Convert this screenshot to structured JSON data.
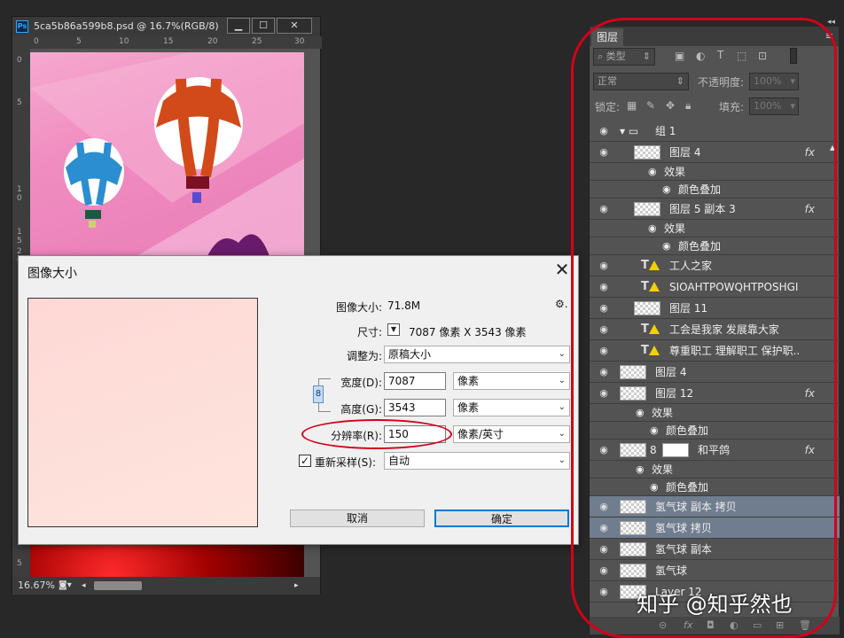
{
  "document": {
    "title": "5ca5b86a599b8.psd @ 16.7%(RGB/8)",
    "app_badge": "Ps",
    "minimize": "▁",
    "maximize": "☐",
    "close": "✕",
    "ruler_top": [
      "0",
      "5",
      "10",
      "15",
      "20",
      "25",
      "30"
    ],
    "ruler_left": [
      "0",
      "5",
      "1",
      "0",
      "1",
      "5",
      "2",
      "0",
      "5"
    ],
    "zoom": "16.67%"
  },
  "dialog": {
    "title": "图像大小",
    "close": "✕",
    "image_size_label": "图像大小:",
    "image_size_value": "71.8M",
    "dimensions_label": "尺寸:",
    "dimensions_value": "7087 像素  X  3543 像素",
    "fit_label": "调整为:",
    "fit_value": "原稿大小",
    "width_label": "宽度(D):",
    "width_value": "7087",
    "width_unit": "像素",
    "height_label": "高度(G):",
    "height_value": "3543",
    "height_unit": "像素",
    "resolution_label": "分辨率(R):",
    "resolution_value": "150",
    "resolution_unit": "像素/英寸",
    "resample_label": "重新采样(S):",
    "resample_checked": "✓",
    "resample_value": "自动",
    "cancel": "取消",
    "ok": "确定",
    "gear": "⚙."
  },
  "layers_panel": {
    "tab": "图层",
    "filter_kind": "类型",
    "blend_mode": "正常",
    "opacity_label": "不透明度:",
    "opacity_value": "100%",
    "lock_label": "锁定:",
    "fill_label": "填充:",
    "fill_value": "100%",
    "layers": [
      {
        "name": "组 1",
        "kind": "group"
      },
      {
        "name": "图层 4",
        "kind": "pixel",
        "fx": "fx"
      },
      {
        "name": "效果",
        "kind": "effect"
      },
      {
        "name": "颜色叠加",
        "kind": "subeffect"
      },
      {
        "name": "图层 5 副本 3",
        "kind": "pixel",
        "fx": "fx"
      },
      {
        "name": "效果",
        "kind": "effect"
      },
      {
        "name": "颜色叠加",
        "kind": "subeffect"
      },
      {
        "name": "工人之家",
        "kind": "text"
      },
      {
        "name": "SIOAHTPOWQHTPOSHGIOSH...",
        "kind": "text"
      },
      {
        "name": "图层 11",
        "kind": "pixel"
      },
      {
        "name": "工会是我家  发展靠大家",
        "kind": "text"
      },
      {
        "name": "尊重职工  理解职工  保护职...",
        "kind": "text"
      },
      {
        "name": "图层 4",
        "kind": "pixel"
      },
      {
        "name": "图层 12",
        "kind": "pixel",
        "fx": "fx"
      },
      {
        "name": "效果",
        "kind": "effect"
      },
      {
        "name": "颜色叠加",
        "kind": "subeffect"
      },
      {
        "name": "和平鸽",
        "kind": "masked",
        "fx": "fx"
      },
      {
        "name": "效果",
        "kind": "effect"
      },
      {
        "name": "颜色叠加",
        "kind": "subeffect"
      },
      {
        "name": "氢气球 副本 拷贝",
        "kind": "pixel",
        "selected": true
      },
      {
        "name": "氢气球 拷贝",
        "kind": "pixel",
        "selected": true
      },
      {
        "name": "氢气球 副本",
        "kind": "pixel"
      },
      {
        "name": "氢气球",
        "kind": "pixel"
      },
      {
        "name": "Layer 12",
        "kind": "pixel"
      }
    ]
  },
  "watermark": "知乎 @知乎然也",
  "colors": {
    "annotation": "#d4001a",
    "selected_row": "#6f7d8f",
    "ok_border": "#0078d7"
  }
}
